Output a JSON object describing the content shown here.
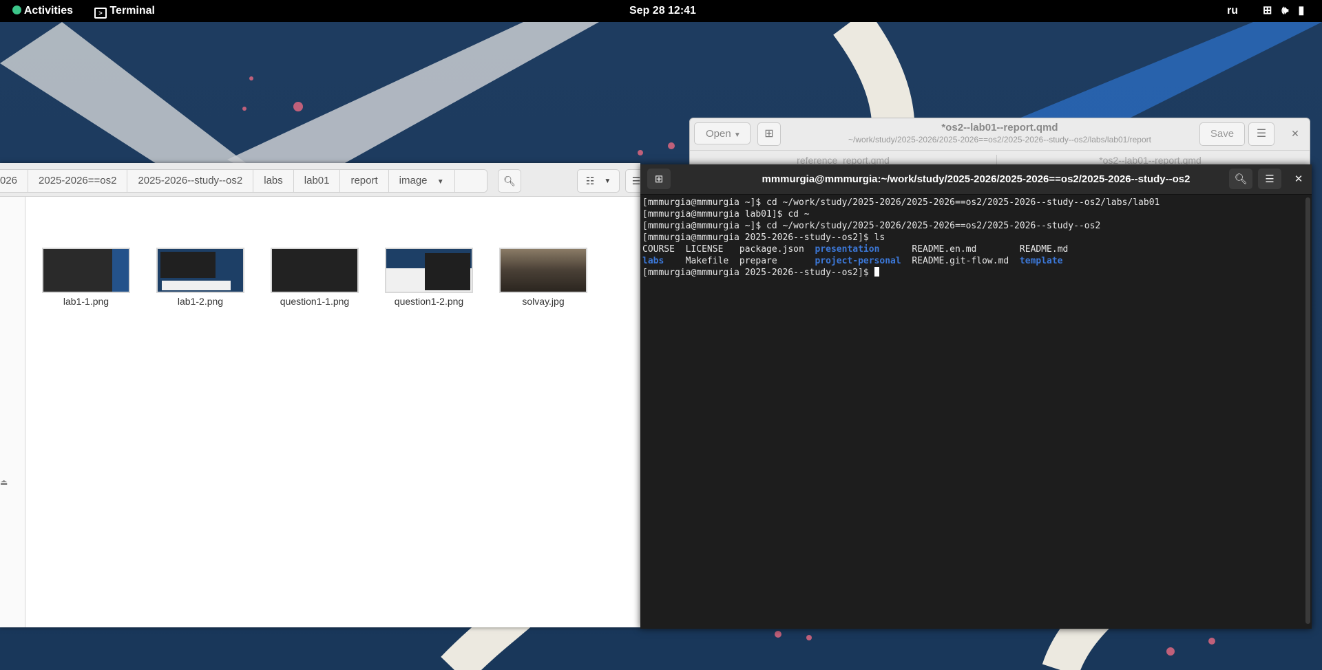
{
  "topbar": {
    "activities": "Activities",
    "app_name": "Terminal",
    "clock": "Sep 28  12:41",
    "keyboard_layout": "ru",
    "icons": [
      "network-icon",
      "volume-icon",
      "battery-icon"
    ]
  },
  "files": {
    "breadcrumbs": [
      "026",
      "2025-2026==os2",
      "2025-2026--study--os2",
      "labs",
      "lab01",
      "report",
      "image"
    ],
    "items": [
      {
        "name": "lab1-1.png"
      },
      {
        "name": "lab1-2.png"
      },
      {
        "name": "question1-1.png"
      },
      {
        "name": "question1-2.png"
      },
      {
        "name": "solvay.jpg"
      }
    ]
  },
  "gedit": {
    "open_label": "Open",
    "title": "*os2--lab01--report.qmd",
    "subtitle": "~/work/study/2025-2026/2025-2026==os2/2025-2026--study--os2/labs/lab01/report",
    "save_label": "Save",
    "tabs": [
      "reference_report.qmd",
      "*os2--lab01--report.qmd"
    ]
  },
  "terminal": {
    "title": "mmmurgia@mmmurgia:~/work/study/2025-2026/2025-2026==os2/2025-2026--study--os2",
    "lines": [
      "[mmmurgia@mmmurgia ~]$ cd ~/work/study/2025-2026/2025-2026==os2/2025-2026--study--os2/labs/lab01",
      "[mmmurgia@mmmurgia lab01]$ cd ~",
      "[mmmurgia@mmmurgia ~]$ cd ~/work/study/2025-2026/2025-2026==os2/2025-2026--study--os2",
      "[mmmurgia@mmmurgia 2025-2026--study--os2]$ ls"
    ],
    "ls_row1": [
      {
        "text": "COURSE  ",
        "dir": false
      },
      {
        "text": "LICENSE   ",
        "dir": false
      },
      {
        "text": "package.json  ",
        "dir": false
      },
      {
        "text": "presentation",
        "dir": true
      },
      {
        "text": "      ",
        "dir": false
      },
      {
        "text": "README.en.md",
        "dir": false
      },
      {
        "text": "        ",
        "dir": false
      },
      {
        "text": "README.md",
        "dir": false
      }
    ],
    "ls_row2": [
      {
        "text": "labs",
        "dir": true
      },
      {
        "text": "    Makefile  prepare       ",
        "dir": false
      },
      {
        "text": "project-personal",
        "dir": true
      },
      {
        "text": "  README.git-flow.md  ",
        "dir": false
      },
      {
        "text": "template",
        "dir": true
      }
    ],
    "prompt": "[mmmurgia@mmmurgia 2025-2026--study--os2]$ ",
    "dir_color": "#3c78d8"
  }
}
